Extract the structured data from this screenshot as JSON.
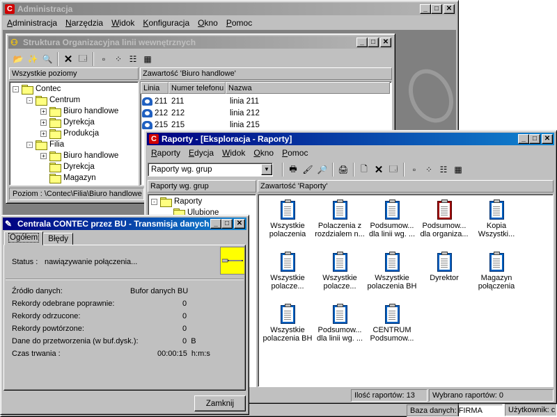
{
  "main_window": {
    "title": "Administracja",
    "menu": [
      "Administracja",
      "Narzędzia",
      "Widok",
      "Konfiguracja",
      "Okno",
      "Pomoc"
    ],
    "status_db": "Baza danych: FIRMA",
    "status_user": "Użytkownik: c"
  },
  "struct_window": {
    "title": "Struktura Organizacyjna linii wewnętrznych",
    "left_header": "Wszystkie poziomy",
    "right_header": "Zawartość 'Biuro handlowe'",
    "tree": [
      {
        "label": "Contec",
        "expander": "-"
      },
      {
        "label": "Centrum",
        "expander": "-"
      },
      {
        "label": "Biuro handlowe",
        "expander": "+"
      },
      {
        "label": "Dyrekcja",
        "expander": "+"
      },
      {
        "label": "Produkcja",
        "expander": "+"
      },
      {
        "label": "Filia",
        "expander": "-"
      },
      {
        "label": "Biuro handlowe",
        "expander": "+"
      },
      {
        "label": "Dyrekcja",
        "expander": ""
      },
      {
        "label": "Magazyn",
        "expander": ""
      }
    ],
    "columns": [
      "Linia",
      "Numer telefonu",
      "Nazwa"
    ],
    "rows": [
      [
        "211",
        "211",
        "linia 211"
      ],
      [
        "212",
        "212",
        "linia 212"
      ],
      [
        "215",
        "215",
        "linia 215"
      ]
    ],
    "status_path": "Poziom : \\Contec\\Filia\\Biuro handlowe"
  },
  "reports_window": {
    "title": "Raporty - [Eksploracja - Raporty]",
    "menu": [
      "Raporty",
      "Edycja",
      "Widok",
      "Okno",
      "Pomoc"
    ],
    "combo_value": "Raporty wg. grup",
    "left_header": "Raporty wg. grup",
    "right_header": "Zawartość 'Raporty'",
    "tree": [
      {
        "label": "Raporty",
        "expander": "-"
      },
      {
        "label": "Ulubione",
        "expander": ""
      }
    ],
    "reports": [
      {
        "label": "Wszystkie\npolaczenia",
        "red": false
      },
      {
        "label": "Polaczenia z\nrozdzialem n...",
        "red": false
      },
      {
        "label": "Podsumow...\ndla linii wg. ...",
        "red": false
      },
      {
        "label": "Podsumow...\ndla organiza...",
        "red": true
      },
      {
        "label": "Kopia\nWszystki...",
        "red": false
      },
      {
        "label": "Wszystkie\npolacze...",
        "red": false
      },
      {
        "label": "Wszystkie\npolacze...",
        "red": false
      },
      {
        "label": "Wszystkie\npolaczenia BH",
        "red": false
      },
      {
        "label": "Dyrektor",
        "red": false
      },
      {
        "label": "Magazyn\npołączenia",
        "red": false
      },
      {
        "label": "Wszystkie\npolaczenia BH",
        "red": false
      },
      {
        "label": "Podsumow...\ndla linii wg. ...",
        "red": false
      },
      {
        "label": "CENTRUM\nPodsumow...",
        "red": false
      }
    ],
    "status_count": "Ilość raportów: 13",
    "status_selected": "Wybrano raportów: 0"
  },
  "transfer_dialog": {
    "title": "Centrala CONTEC przez BU - Transmisja danych",
    "tabs": [
      "Ogółem",
      "Błędy"
    ],
    "status_label": "Status :",
    "status_value": "nawiązywanie połączenia...",
    "rows": [
      {
        "label": "Źródło danych:",
        "value": "Bufor danych BU"
      },
      {
        "label": "Rekordy odebrane poprawnie:",
        "value": "0"
      },
      {
        "label": "Rekordy odrzucone:",
        "value": "0"
      },
      {
        "label": "Rekordy powtórzone:",
        "value": "0"
      },
      {
        "label": "Dane do przetworzenia (w buf.dysk.):",
        "value": "0  B"
      },
      {
        "label": "Czas trwania :",
        "value": "00:00:15  h:m:s"
      }
    ],
    "close_label": "Zamknij"
  }
}
